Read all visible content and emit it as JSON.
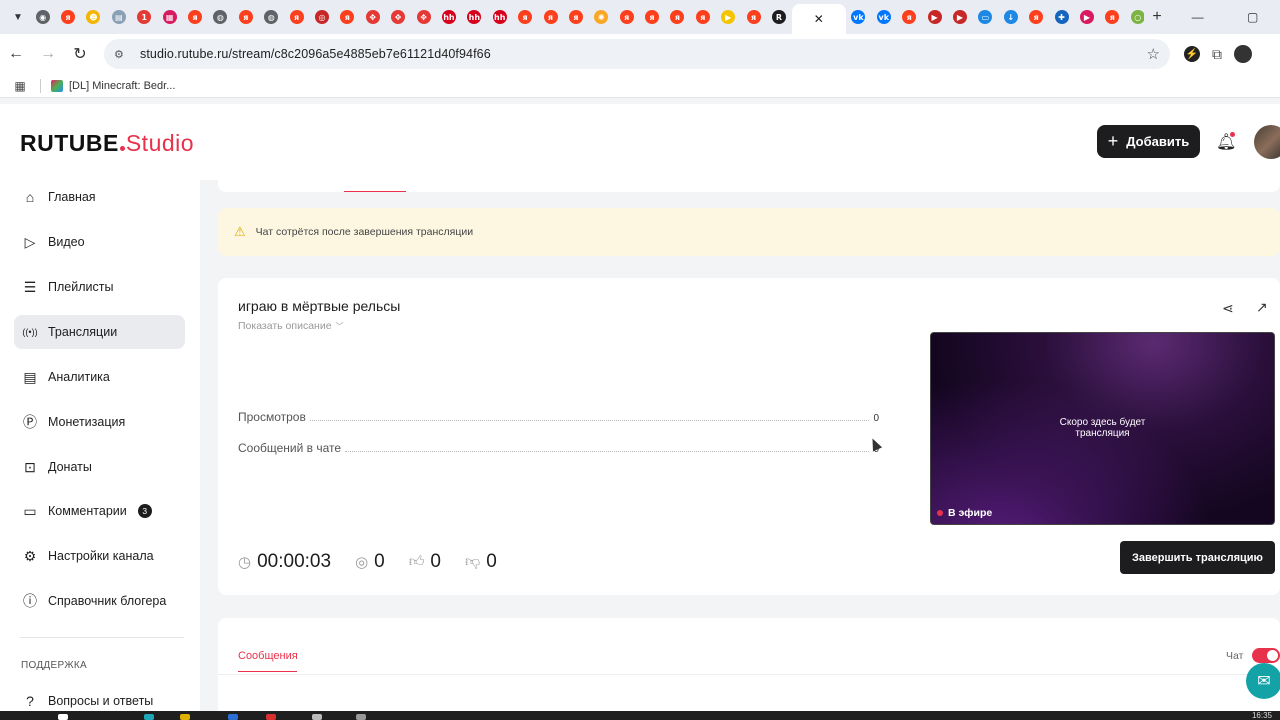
{
  "browser": {
    "tab_favicons": [
      {
        "name": "chrome-icon",
        "color": "#5f6368",
        "glyph": "◉"
      },
      {
        "name": "yandex-icon",
        "color": "#fc3f1d",
        "glyph": "я"
      },
      {
        "name": "smiley-icon",
        "color": "#f5b400",
        "glyph": "☻"
      },
      {
        "name": "printer-icon",
        "color": "#8aa0b5",
        "glyph": "▤"
      },
      {
        "name": "one-icon",
        "color": "#e53935",
        "glyph": "1"
      },
      {
        "name": "chart-icon",
        "color": "#d81b60",
        "glyph": "▦"
      },
      {
        "name": "yandex-icon",
        "color": "#fc3f1d",
        "glyph": "я"
      },
      {
        "name": "globe-icon",
        "color": "#5f6368",
        "glyph": "◍"
      },
      {
        "name": "yandex-icon",
        "color": "#fc3f1d",
        "glyph": "я"
      },
      {
        "name": "globe-icon",
        "color": "#5f6368",
        "glyph": "◍"
      },
      {
        "name": "yandex-icon",
        "color": "#fc3f1d",
        "glyph": "я"
      },
      {
        "name": "opera-icon",
        "color": "#c62828",
        "glyph": "◎"
      },
      {
        "name": "yandex-icon",
        "color": "#fc3f1d",
        "glyph": "я"
      },
      {
        "name": "arrows-icon",
        "color": "#e53935",
        "glyph": "✥"
      },
      {
        "name": "arrows-icon",
        "color": "#e53935",
        "glyph": "✥"
      },
      {
        "name": "arrows-icon",
        "color": "#e53935",
        "glyph": "✥"
      },
      {
        "name": "hh-icon",
        "color": "#d6001c",
        "glyph": "hh"
      },
      {
        "name": "hh-icon",
        "color": "#d6001c",
        "glyph": "hh"
      },
      {
        "name": "hh-icon",
        "color": "#d6001c",
        "glyph": "hh"
      },
      {
        "name": "yandex-icon",
        "color": "#fc3f1d",
        "glyph": "я"
      },
      {
        "name": "yandex-icon",
        "color": "#fc3f1d",
        "glyph": "я"
      },
      {
        "name": "yandex-icon",
        "color": "#fc3f1d",
        "glyph": "я"
      },
      {
        "name": "sun-icon",
        "color": "#f9a825",
        "glyph": "✺"
      },
      {
        "name": "yandex-icon",
        "color": "#fc3f1d",
        "glyph": "я"
      },
      {
        "name": "yandex-icon",
        "color": "#fc3f1d",
        "glyph": "я"
      },
      {
        "name": "yandex-icon",
        "color": "#fc3f1d",
        "glyph": "я"
      },
      {
        "name": "yandex-icon",
        "color": "#fc3f1d",
        "glyph": "я"
      },
      {
        "name": "play-icon",
        "color": "#f5c400",
        "glyph": "▶"
      },
      {
        "name": "yandex-icon",
        "color": "#fc3f1d",
        "glyph": "я"
      },
      {
        "name": "rutube-icon",
        "color": "#1d1d1f",
        "glyph": "R"
      }
    ],
    "tab_favicons_after": [
      {
        "name": "vk-icon",
        "color": "#0077ff",
        "glyph": "vk"
      },
      {
        "name": "vk-icon",
        "color": "#0077ff",
        "glyph": "vk"
      },
      {
        "name": "yandex-icon",
        "color": "#fc3f1d",
        "glyph": "я"
      },
      {
        "name": "youtube-icon",
        "color": "#c62828",
        "glyph": "▶"
      },
      {
        "name": "youtube-icon",
        "color": "#c62828",
        "glyph": "▶"
      },
      {
        "name": "chat-icon",
        "color": "#1e88e5",
        "glyph": "▭"
      },
      {
        "name": "download-icon",
        "color": "#1e88e5",
        "glyph": "↓"
      },
      {
        "name": "yandex-icon",
        "color": "#fc3f1d",
        "glyph": "я"
      },
      {
        "name": "puzzle-icon",
        "color": "#1565c0",
        "glyph": "✚"
      },
      {
        "name": "video-icon",
        "color": "#d81b60",
        "glyph": "▶"
      },
      {
        "name": "yandex-icon",
        "color": "#fc3f1d",
        "glyph": "я"
      },
      {
        "name": "circle-icon",
        "color": "#7cb342",
        "glyph": "○"
      },
      {
        "name": "yandex-icon",
        "color": "#fc3f1d",
        "glyph": "я"
      }
    ],
    "url": "studio.rutube.ru/stream/c8c2096a5e4885eb7e61121d40f94f66",
    "bookmark": "[DL] Minecraft: Bedr..."
  },
  "header": {
    "logo_main": "RUTUBE",
    "logo_sub": "Studio",
    "add_label": "Добавить"
  },
  "sidebar": {
    "items": [
      {
        "label": "Главная",
        "icon": "home-icon"
      },
      {
        "label": "Видео",
        "icon": "video-icon"
      },
      {
        "label": "Плейлисты",
        "icon": "playlist-icon"
      },
      {
        "label": "Трансляции",
        "icon": "broadcast-icon"
      },
      {
        "label": "Аналитика",
        "icon": "analytics-icon"
      },
      {
        "label": "Монетизация",
        "icon": "monetization-icon"
      },
      {
        "label": "Донаты",
        "icon": "donate-icon"
      },
      {
        "label": "Комментарии",
        "icon": "comments-icon",
        "badge": "3"
      },
      {
        "label": "Настройки канала",
        "icon": "settings-icon"
      },
      {
        "label": "Справочник блогера",
        "icon": "info-icon"
      }
    ],
    "section_title": "ПОДДЕРЖКА",
    "support_items": [
      {
        "label": "Вопросы и ответы",
        "icon": "help-icon"
      }
    ]
  },
  "notice": {
    "text": "Чат сотрётся после завершения трансляции"
  },
  "stream": {
    "title": "играю в мёртвые рельсы",
    "show_description": "Показать описание",
    "stats": [
      {
        "label": "Просмотров",
        "value": "0"
      },
      {
        "label": "Сообщений в чате",
        "value": "0"
      }
    ],
    "timer": "00:00:03",
    "viewers": "0",
    "likes": "0",
    "dislikes": "0",
    "player_text_line1": "Скоро здесь будет",
    "player_text_line2": "трансляция",
    "live_label": "В эфире",
    "end_button": "Завершить трансляцию"
  },
  "messages": {
    "tab_label": "Сообщения",
    "chat_label": "Чат",
    "chat_enabled": true
  },
  "taskbar": {
    "clock": "16:35"
  }
}
